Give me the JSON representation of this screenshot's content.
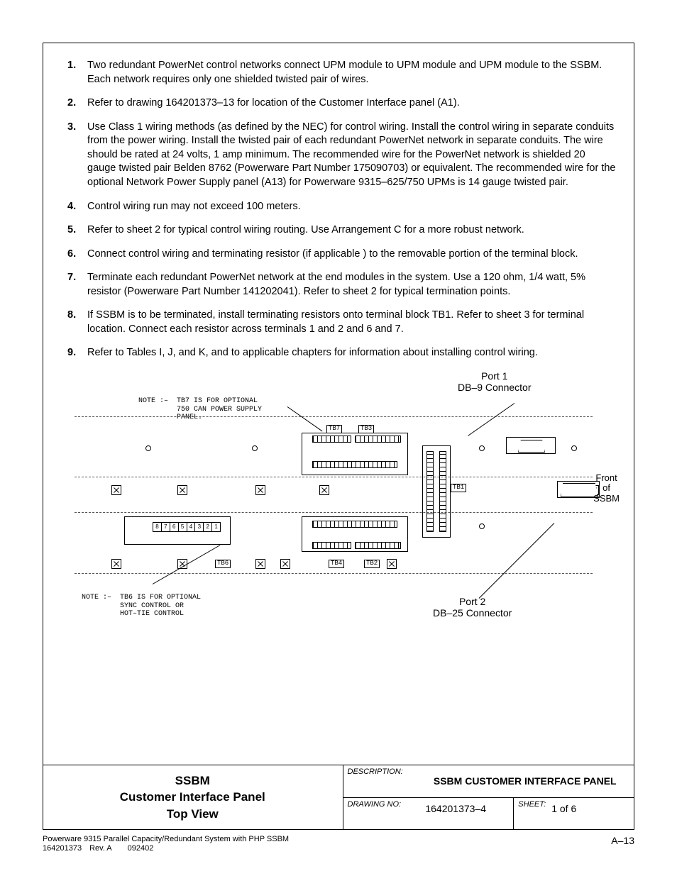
{
  "notes": [
    "Two redundant PowerNet control networks connect UPM module to UPM module and UPM module to the SSBM.  Each network requires only one shielded twisted pair of wires.",
    "Refer to drawing 164201373–13 for location of the Customer Interface panel (A1).",
    "Use Class 1 wiring methods (as defined by the NEC) for control wiring.  Install the control wiring in separate conduits from the power wiring.  Install the twisted pair of each redundant PowerNet network in separate conduits.  The wire should be rated at 24 volts, 1 amp minimum.  The recommended wire for the PowerNet network is shielded 20 gauge twisted pair Belden 8762 (Powerware Part Number 175090703) or equivalent.  The recommended wire for the optional Network Power Supply panel (A13) for Powerware 9315–625/750 UPMs is 14 gauge twisted pair.",
    "Control wiring run may not exceed 100 meters.",
    "Refer to sheet 2 for typical control wiring routing.  Use Arrangement C for a more robust network.",
    "Connect control wiring and terminating resistor (if applicable ) to the removable portion of the terminal block.",
    "Terminate each redundant PowerNet network at the end modules in the system.  Use a 120 ohm, 1/4 watt, 5% resistor (Powerware Part Number 141202041).  Refer to sheet 2 for typical termination points.",
    "If SSBM is to be terminated, install terminating resistors onto terminal block TB1.  Refer to sheet 3 for terminal location.  Connect each resistor across terminals 1 and 2 and 6 and 7.",
    "Refer to Tables I, J, and K, and to applicable chapters for information about installing control wiring."
  ],
  "diagram": {
    "port1_line1": "Port 1",
    "port1_line2": "DB–9 Connector",
    "port2_line1": "Port 2",
    "port2_line2": "DB–25 Connector",
    "note_tb7": "NOTE :–  TB7 IS FOR OPTIONAL\n         750 CAN POWER SUPPLY\n         PANEL.",
    "note_tb6": "NOTE :–  TB6 IS FOR OPTIONAL\n         SYNC CONTROL OR\n         HOT–TIE CONTROL",
    "front_line1": "Front",
    "front_line2": "of",
    "front_line3": "SSBM",
    "tb_labels": {
      "tb1": "TB1",
      "tb2": "TB2",
      "tb3": "TB3",
      "tb4": "TB4",
      "tb6": "TB6",
      "tb7": "TB7"
    },
    "tb6_digits": [
      "8",
      "7",
      "6",
      "5",
      "4",
      "3",
      "2",
      "1"
    ]
  },
  "title_block": {
    "left_title": "SSBM\nCustomer Interface Panel\nTop View",
    "description_label": "DESCRIPTION:",
    "description_value": "SSBM CUSTOMER INTERFACE PANEL",
    "drawing_label": "DRAWING NO:",
    "drawing_value": "164201373–4",
    "sheet_label": "SHEET:",
    "sheet_value": "1 of 6"
  },
  "footer": {
    "line1": "Powerware 9315 Parallel Capacity/Redundant System with PHP SSBM",
    "line2": "164201373 Rev. A  092402",
    "page_no": "A–13"
  }
}
